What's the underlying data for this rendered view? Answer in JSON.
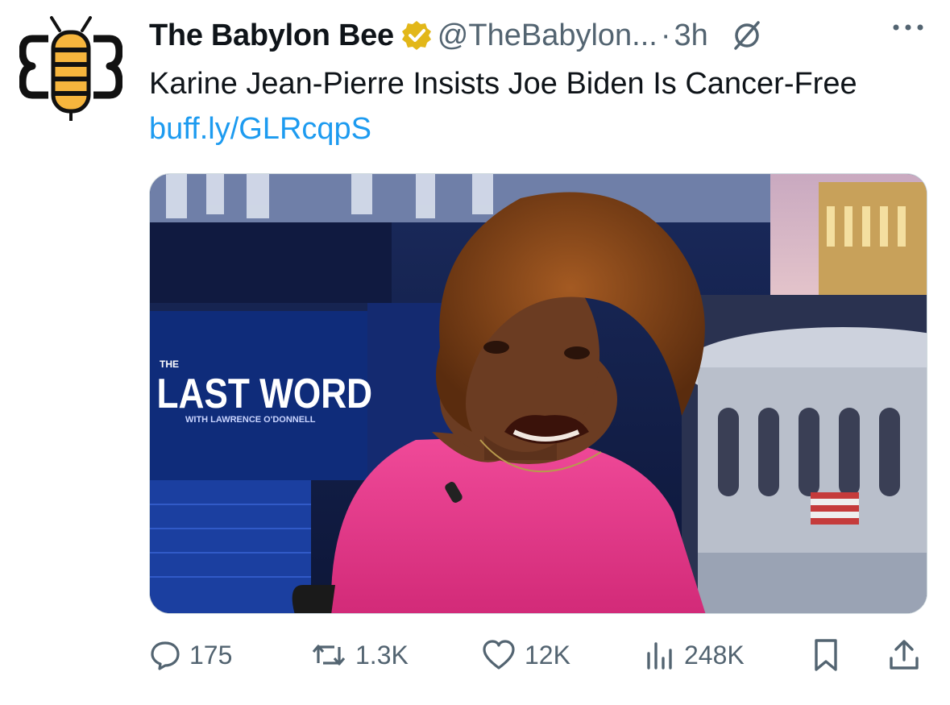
{
  "tweet": {
    "author_name": "The Babylon Bee",
    "handle": "@TheBabylon...",
    "separator": "·",
    "time": "3h",
    "text": "Karine Jean-Pierre Insists Joe Biden Is Cancer-Free",
    "link": "buff.ly/GLRcqpS"
  },
  "media": {
    "overlay_title_small": "THE",
    "overlay_title": "LAST WORD",
    "overlay_subtitle": "WITH LAWRENCE O'DONNELL"
  },
  "actions": {
    "replies": "175",
    "reposts": "1.3K",
    "likes": "12K",
    "views": "248K"
  },
  "colors": {
    "accent": "#1d9bf0",
    "muted": "#536471",
    "badge_gold": "#e2b719",
    "bee_yellow": "#f6b53d",
    "shirt_pink": "#e8398c"
  },
  "icons": [
    "babylon-bee-logo",
    "verified-badge-icon",
    "grok-icon",
    "more-icon",
    "reply-icon",
    "repost-icon",
    "like-icon",
    "views-icon",
    "bookmark-icon",
    "share-icon"
  ]
}
